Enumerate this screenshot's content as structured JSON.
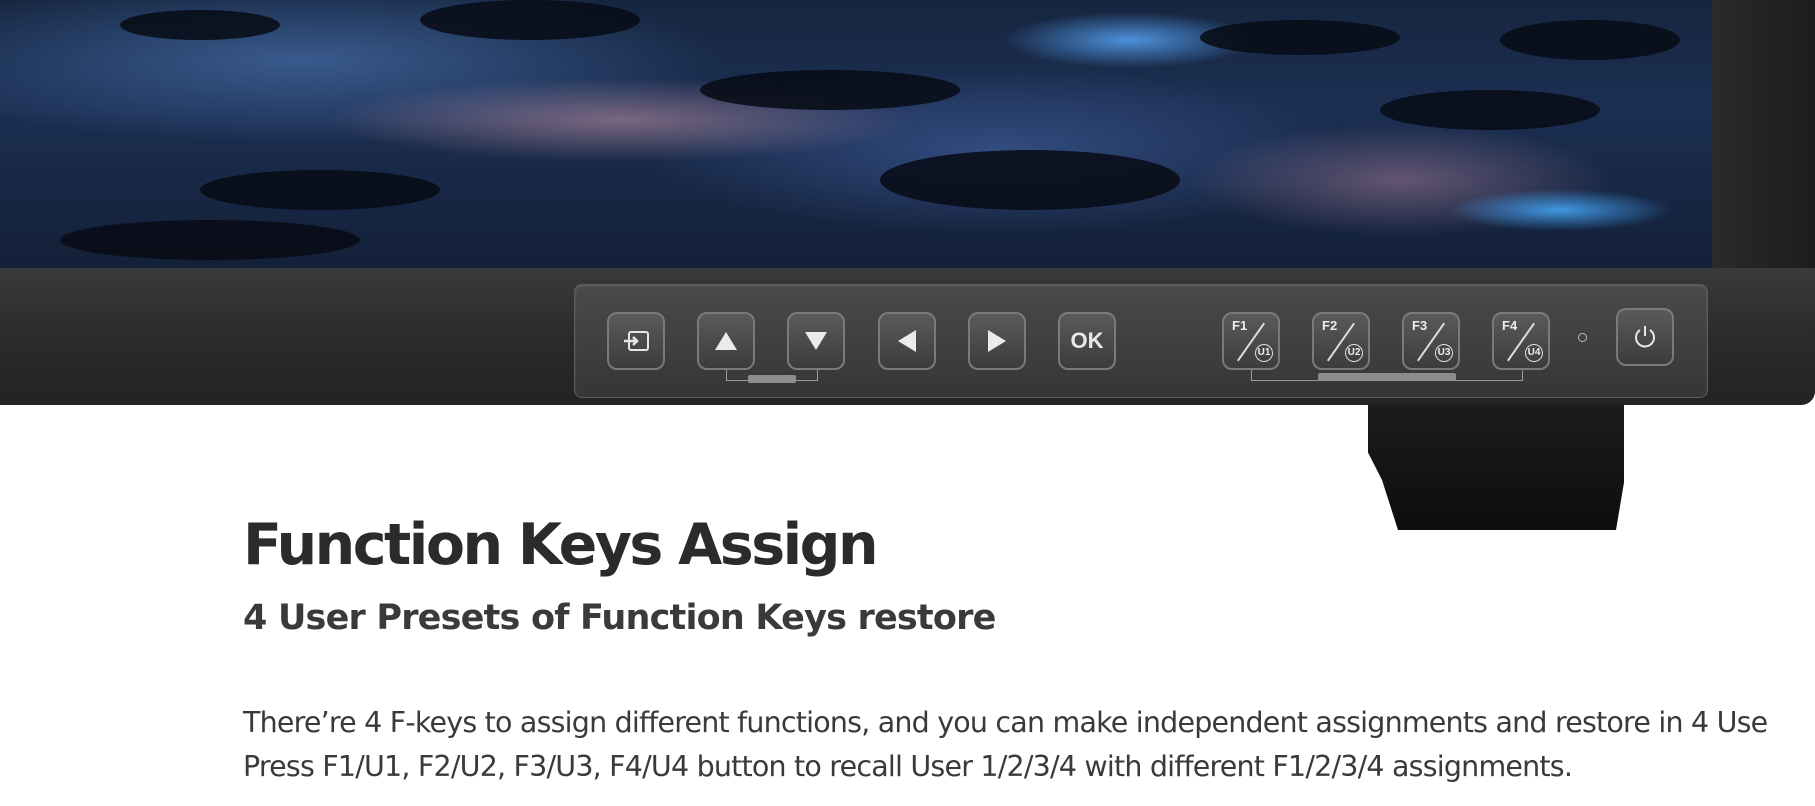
{
  "hero": {
    "monitor_keys": [
      {
        "id": "input",
        "icon": "input-source-icon"
      },
      {
        "id": "up",
        "icon": "arrow-up-icon"
      },
      {
        "id": "down",
        "icon": "arrow-down-icon"
      },
      {
        "id": "left",
        "icon": "arrow-left-icon"
      },
      {
        "id": "right",
        "icon": "arrow-right-icon"
      },
      {
        "id": "ok",
        "label": "OK"
      },
      {
        "id": "f1",
        "label": "F1",
        "sub": "U1"
      },
      {
        "id": "f2",
        "label": "F2",
        "sub": "U2"
      },
      {
        "id": "f3",
        "label": "F3",
        "sub": "U3"
      },
      {
        "id": "f4",
        "label": "F4",
        "sub": "U4"
      },
      {
        "id": "power",
        "icon": "power-icon"
      }
    ]
  },
  "section": {
    "title": "Function Keys Assign",
    "subtitle": "4 User Presets of Function Keys restore",
    "body_line1": "There’re 4 F-keys to assign different functions, and you can make independent assignments and restore in 4 Use",
    "body_line2": "Press F1/U1, F2/U2, F3/U3, F4/U4 button to recall User 1/2/3/4 with different F1/2/3/4 assignments."
  }
}
